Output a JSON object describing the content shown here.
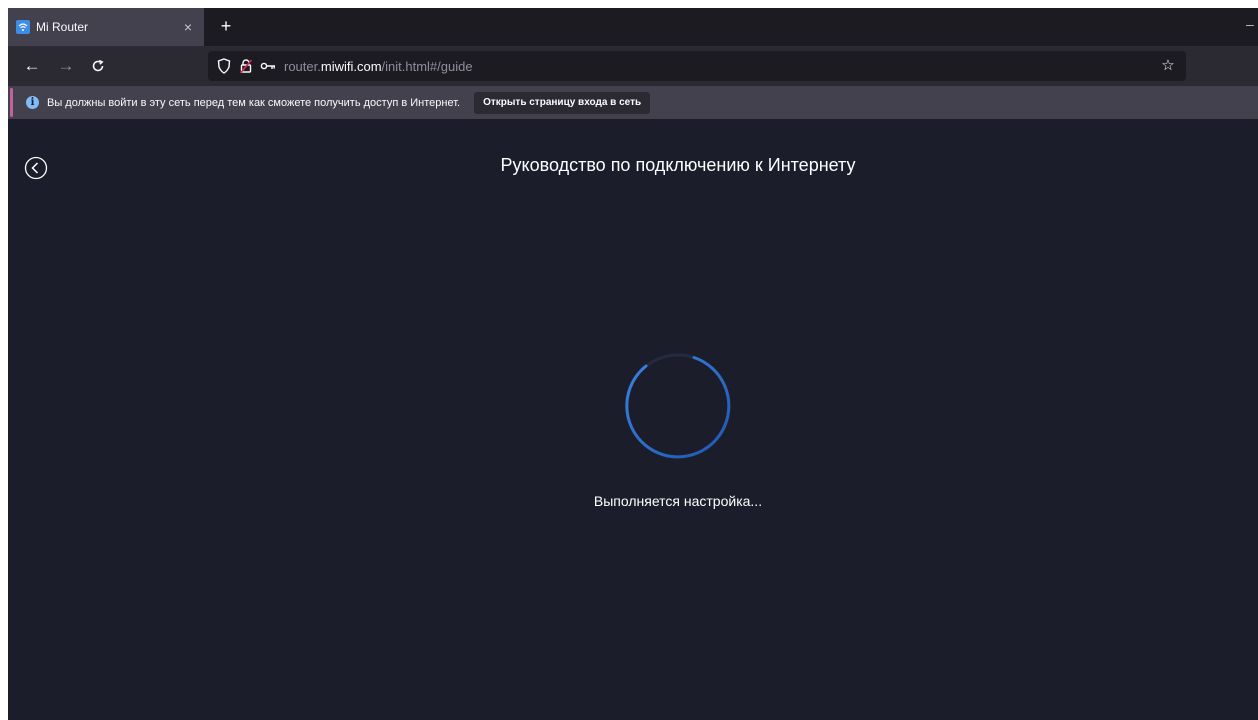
{
  "browser": {
    "tab": {
      "title": "Mi Router",
      "close": "×"
    },
    "new_tab": "+",
    "nav": {
      "back": "←",
      "forward": "→",
      "reload": "C"
    },
    "url": {
      "prefix": "router.",
      "host": "miwifi.com",
      "path": "/init.html#/guide"
    },
    "bookmark": "☆"
  },
  "notification": {
    "text": "Вы должны войти в эту сеть перед тем как сможете получить доступ в Интернет.",
    "button_label": "Открыть страницу входа в сеть",
    "info_glyph": "i"
  },
  "page": {
    "title": "Руководство по подключению к Интернету",
    "status": "Выполняется настройка..."
  },
  "colors": {
    "page_bg": "#1b1d2b",
    "spinner": "#3b82e0",
    "accent": "#c3629a"
  }
}
